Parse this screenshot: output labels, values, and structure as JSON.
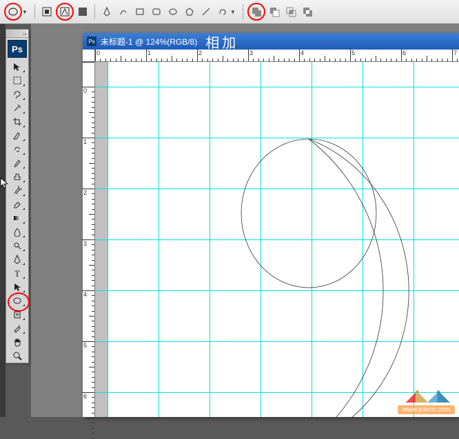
{
  "options_bar": {
    "tool_preset": "ellipse-tool-icon",
    "mode_shape_layer": "shape-layers-icon",
    "mode_paths": "paths-icon",
    "mode_fill": "fill-pixels-icon",
    "shape_rect": "rectangle-icon",
    "shape_rrect": "rounded-rect-icon",
    "shape_ellipse": "ellipse-icon",
    "shape_polygon": "polygon-icon",
    "shape_line": "line-icon",
    "shape_custom": "custom-shape-icon",
    "combine_add": "add-to-shape-icon",
    "combine_subtract": "subtract-icon",
    "combine_intersect": "intersect-icon",
    "combine_exclude": "exclude-icon"
  },
  "tools": {
    "ps": "Ps",
    "items": [
      "move-tool",
      "marquee-tool",
      "lasso-tool",
      "wand-tool",
      "crop-tool",
      "slice-tool",
      "heal-tool",
      "brush-tool",
      "stamp-tool",
      "history-brush-tool",
      "eraser-tool",
      "gradient-tool",
      "blur-tool",
      "dodge-tool",
      "pen-tool",
      "type-tool",
      "path-select-tool",
      "ellipse-shape-tool",
      "notes-tool",
      "eyedropper-tool",
      "hand-tool",
      "zoom-tool"
    ]
  },
  "document": {
    "title": "未标题-1 @ 124%(RGB/8)",
    "annotation": "相加",
    "ruler_units": [
      "0",
      "1",
      "2",
      "3",
      "4",
      "5",
      "6",
      "7"
    ],
    "ruler_units_v": [
      "0",
      "1",
      "2",
      "3",
      "4",
      "5",
      "6"
    ]
  },
  "watermark": {
    "site": "www.jcwcn.com"
  }
}
